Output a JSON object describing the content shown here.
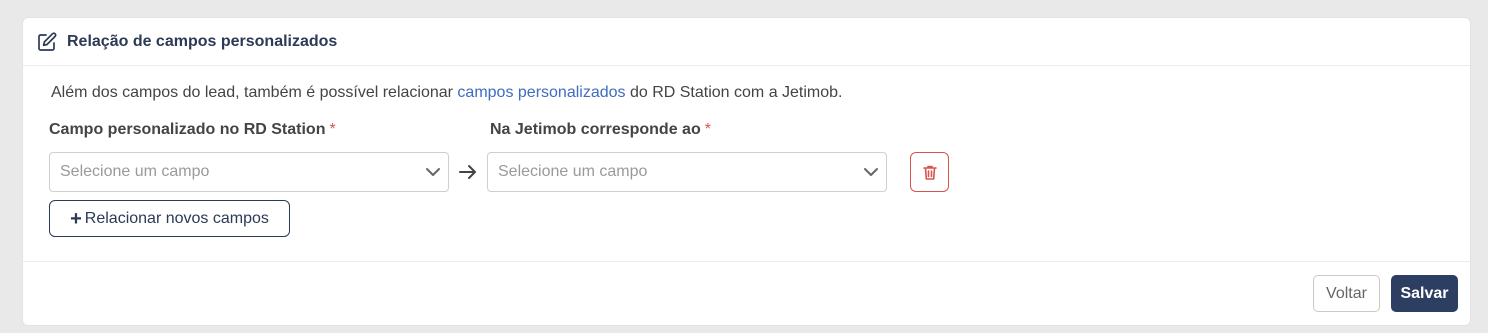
{
  "header": {
    "title": "Relação de campos personalizados",
    "icon": "edit-icon"
  },
  "intro": {
    "before": "Além dos campos do lead, também é possível relacionar ",
    "link": "campos personalizados",
    "after": " do RD Station com a Jetimob."
  },
  "mapping": {
    "rd_label": "Campo personalizado no RD Station",
    "jetimob_label": "Na Jetimob corresponde ao",
    "required_mark": "*",
    "rd_placeholder": "Selecione um campo",
    "jetimob_placeholder": "Selecione um campo"
  },
  "actions": {
    "add_label": "Relacionar novos campos",
    "back_label": "Voltar",
    "save_label": "Salvar"
  },
  "colors": {
    "primary": "#2c3f63",
    "link": "#3d6cc0",
    "danger": "#d9534f"
  }
}
